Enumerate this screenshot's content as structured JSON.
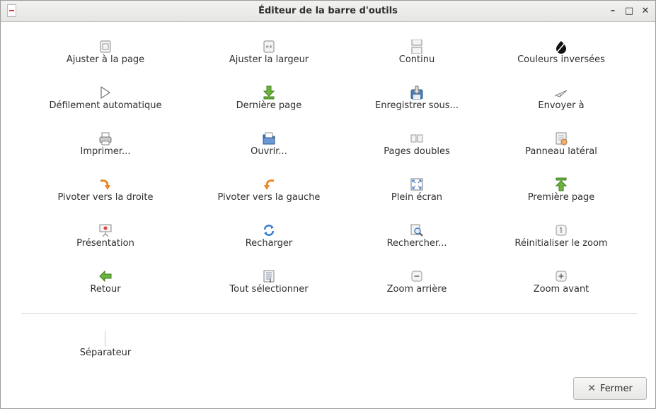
{
  "window": {
    "title": "Éditeur de la barre d'outils",
    "minimize_glyph": "–",
    "maximize_glyph": "□",
    "close_glyph": "✕"
  },
  "items": [
    {
      "label": "Ajuster à la page",
      "icon": "fit-page-icon"
    },
    {
      "label": "Ajuster la largeur",
      "icon": "fit-width-icon"
    },
    {
      "label": "Continu",
      "icon": "continuous-icon"
    },
    {
      "label": "Couleurs inversées",
      "icon": "invert-colors-icon"
    },
    {
      "label": "Défilement automatique",
      "icon": "play-icon"
    },
    {
      "label": "Dernière page",
      "icon": "last-page-icon"
    },
    {
      "label": "Enregistrer sous...",
      "icon": "save-as-icon"
    },
    {
      "label": "Envoyer à",
      "icon": "send-to-icon"
    },
    {
      "label": "Imprimer...",
      "icon": "print-icon"
    },
    {
      "label": "Ouvrir...",
      "icon": "open-folder-icon"
    },
    {
      "label": "Pages doubles",
      "icon": "dual-page-icon"
    },
    {
      "label": "Panneau latéral",
      "icon": "side-panel-icon"
    },
    {
      "label": "Pivoter vers la droite",
      "icon": "rotate-right-icon"
    },
    {
      "label": "Pivoter vers la gauche",
      "icon": "rotate-left-icon"
    },
    {
      "label": "Plein écran",
      "icon": "fullscreen-icon"
    },
    {
      "label": "Première page",
      "icon": "first-page-icon"
    },
    {
      "label": "Présentation",
      "icon": "presentation-icon"
    },
    {
      "label": "Recharger",
      "icon": "reload-icon"
    },
    {
      "label": "Rechercher...",
      "icon": "search-icon"
    },
    {
      "label": "Réinitialiser le zoom",
      "icon": "zoom-reset-icon"
    },
    {
      "label": "Retour",
      "icon": "back-icon"
    },
    {
      "label": "Tout sélectionner",
      "icon": "select-all-icon"
    },
    {
      "label": "Zoom arrière",
      "icon": "zoom-out-icon"
    },
    {
      "label": "Zoom avant",
      "icon": "zoom-in-icon"
    }
  ],
  "separator": {
    "label": "Séparateur"
  },
  "close_button": {
    "label": "Fermer",
    "icon": "close-icon"
  }
}
